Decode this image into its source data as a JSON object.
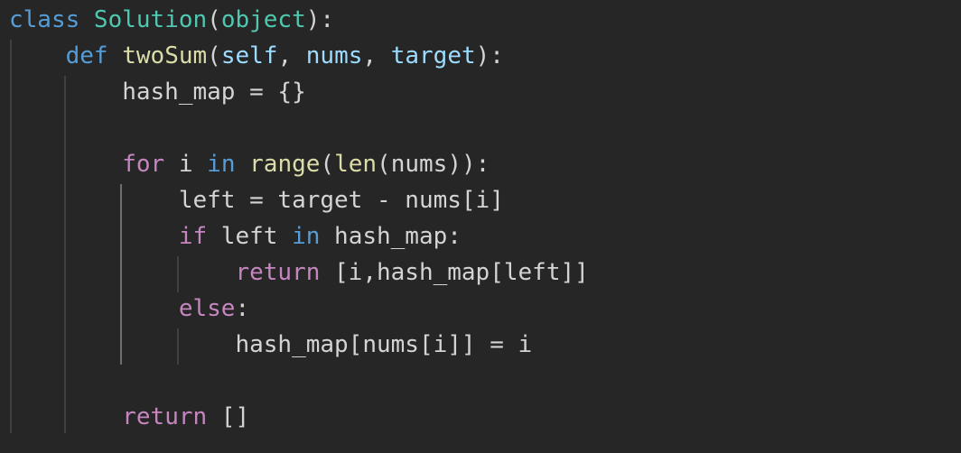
{
  "editor": {
    "lines": [
      {
        "tokens": [
          {
            "text": "class ",
            "kind": "kw-blue"
          },
          {
            "text": "Solution",
            "kind": "cls"
          },
          {
            "text": "(",
            "kind": "plain"
          },
          {
            "text": "object",
            "kind": "cls"
          },
          {
            "text": "):",
            "kind": "plain"
          }
        ]
      },
      {
        "tokens": [
          {
            "text": "    ",
            "kind": "plain"
          },
          {
            "text": "def ",
            "kind": "kw-blue"
          },
          {
            "text": "twoSum",
            "kind": "fn"
          },
          {
            "text": "(",
            "kind": "plain"
          },
          {
            "text": "self",
            "kind": "param"
          },
          {
            "text": ", ",
            "kind": "plain"
          },
          {
            "text": "nums",
            "kind": "param"
          },
          {
            "text": ", ",
            "kind": "plain"
          },
          {
            "text": "target",
            "kind": "param"
          },
          {
            "text": "):",
            "kind": "plain"
          }
        ]
      },
      {
        "tokens": [
          {
            "text": "        hash_map = {}",
            "kind": "plain"
          }
        ]
      },
      {
        "tokens": []
      },
      {
        "tokens": [
          {
            "text": "        ",
            "kind": "plain"
          },
          {
            "text": "for",
            "kind": "kw-purple"
          },
          {
            "text": " i ",
            "kind": "plain"
          },
          {
            "text": "in",
            "kind": "kw-blue"
          },
          {
            "text": " ",
            "kind": "plain"
          },
          {
            "text": "range",
            "kind": "fn"
          },
          {
            "text": "(",
            "kind": "plain"
          },
          {
            "text": "len",
            "kind": "fn"
          },
          {
            "text": "(nums)):",
            "kind": "plain"
          }
        ]
      },
      {
        "tokens": [
          {
            "text": "            left = target - nums[i]",
            "kind": "plain"
          }
        ]
      },
      {
        "tokens": [
          {
            "text": "            ",
            "kind": "plain"
          },
          {
            "text": "if",
            "kind": "kw-purple"
          },
          {
            "text": " left ",
            "kind": "plain"
          },
          {
            "text": "in",
            "kind": "kw-blue"
          },
          {
            "text": " hash_map:",
            "kind": "plain"
          }
        ]
      },
      {
        "tokens": [
          {
            "text": "                ",
            "kind": "plain"
          },
          {
            "text": "return",
            "kind": "kw-purple"
          },
          {
            "text": " [i,hash_map[left]]",
            "kind": "plain"
          }
        ]
      },
      {
        "tokens": [
          {
            "text": "            ",
            "kind": "plain"
          },
          {
            "text": "else",
            "kind": "kw-purple"
          },
          {
            "text": ":",
            "kind": "plain"
          }
        ]
      },
      {
        "tokens": [
          {
            "text": "                hash_map[nums[i]] = i",
            "kind": "plain"
          }
        ]
      },
      {
        "tokens": []
      },
      {
        "tokens": [
          {
            "text": "        ",
            "kind": "plain"
          },
          {
            "text": "return",
            "kind": "kw-purple"
          },
          {
            "text": " []",
            "kind": "plain"
          }
        ]
      }
    ]
  },
  "colors": {
    "background": "#262626",
    "keyword_blue": "#569cd6",
    "keyword_purple": "#c586c0",
    "class_name": "#4ec9b0",
    "function_name": "#dcdcaa",
    "parameter": "#9cdcfe",
    "text": "#d4d4d4",
    "indent_guide": "#404040"
  }
}
